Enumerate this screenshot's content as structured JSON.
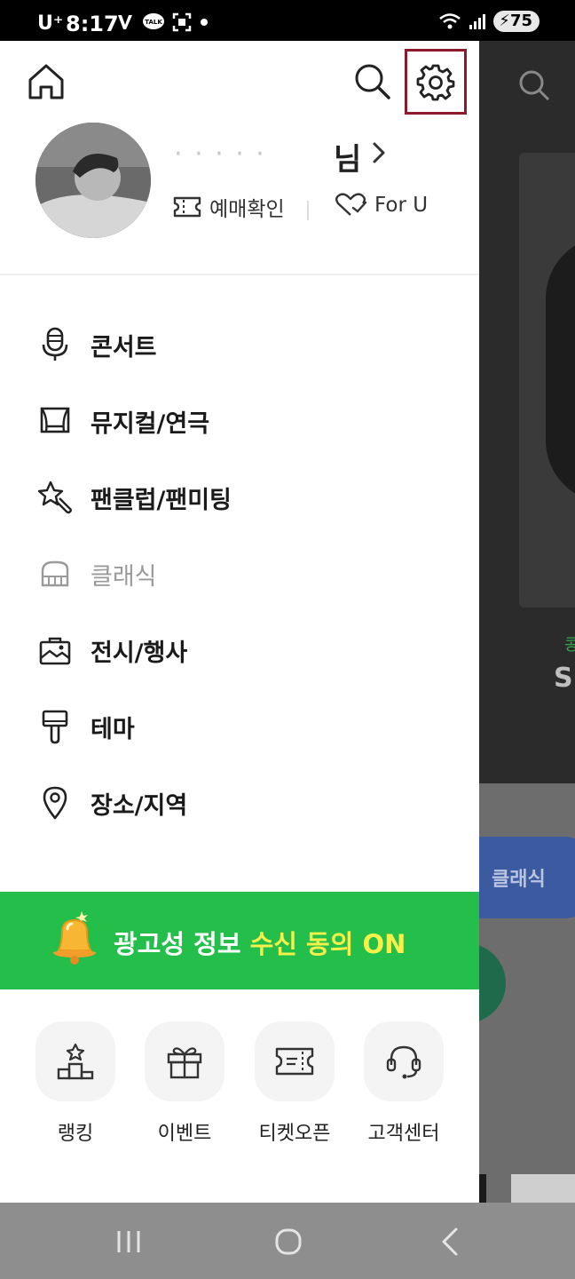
{
  "status_bar": {
    "carrier": "U⁺",
    "time": "8:17",
    "battery": "75",
    "icons": [
      "kakao-v-icon",
      "kakaotalk-icon",
      "screenshot-icon",
      "dot-icon",
      "wifi-icon",
      "signal-icon"
    ]
  },
  "header": {
    "icons": [
      "home-icon",
      "search-icon",
      "settings-icon"
    ],
    "highlight_color": "#8c1a2b"
  },
  "profile": {
    "nickname_masked": "·        ·   ·  ·    ·",
    "nickname_suffix": "님",
    "booking_label": "예매확인",
    "foru_label": "For U"
  },
  "menu": {
    "items": [
      {
        "label": "콘서트",
        "icon": "microphone-icon"
      },
      {
        "label": "뮤지컬/연극",
        "icon": "theater-stage-icon"
      },
      {
        "label": "팬클럽/팬미팅",
        "icon": "star-wand-icon"
      },
      {
        "label": "클래식",
        "icon": "piano-icon"
      },
      {
        "label": "전시/행사",
        "icon": "exhibition-icon"
      },
      {
        "label": "테마",
        "icon": "paint-brush-icon"
      },
      {
        "label": "장소/지역",
        "icon": "location-pin-icon"
      }
    ]
  },
  "banner": {
    "text_part1": "광고성 정보 ",
    "text_highlight": "수신 동의 ON",
    "bg_color": "#23bf4a",
    "highlight_color": "#f5f04a"
  },
  "quick_menu": {
    "items": [
      {
        "label": "랭킹",
        "icon": "podium-icon"
      },
      {
        "label": "이벤트",
        "icon": "gift-icon"
      },
      {
        "label": "티켓오픈",
        "icon": "ticket-icon"
      },
      {
        "label": "고객센터",
        "icon": "headset-icon"
      }
    ]
  },
  "background_app": {
    "chip_label": "클래식",
    "title_fragment": "S.J",
    "green_fragment": "콩"
  }
}
